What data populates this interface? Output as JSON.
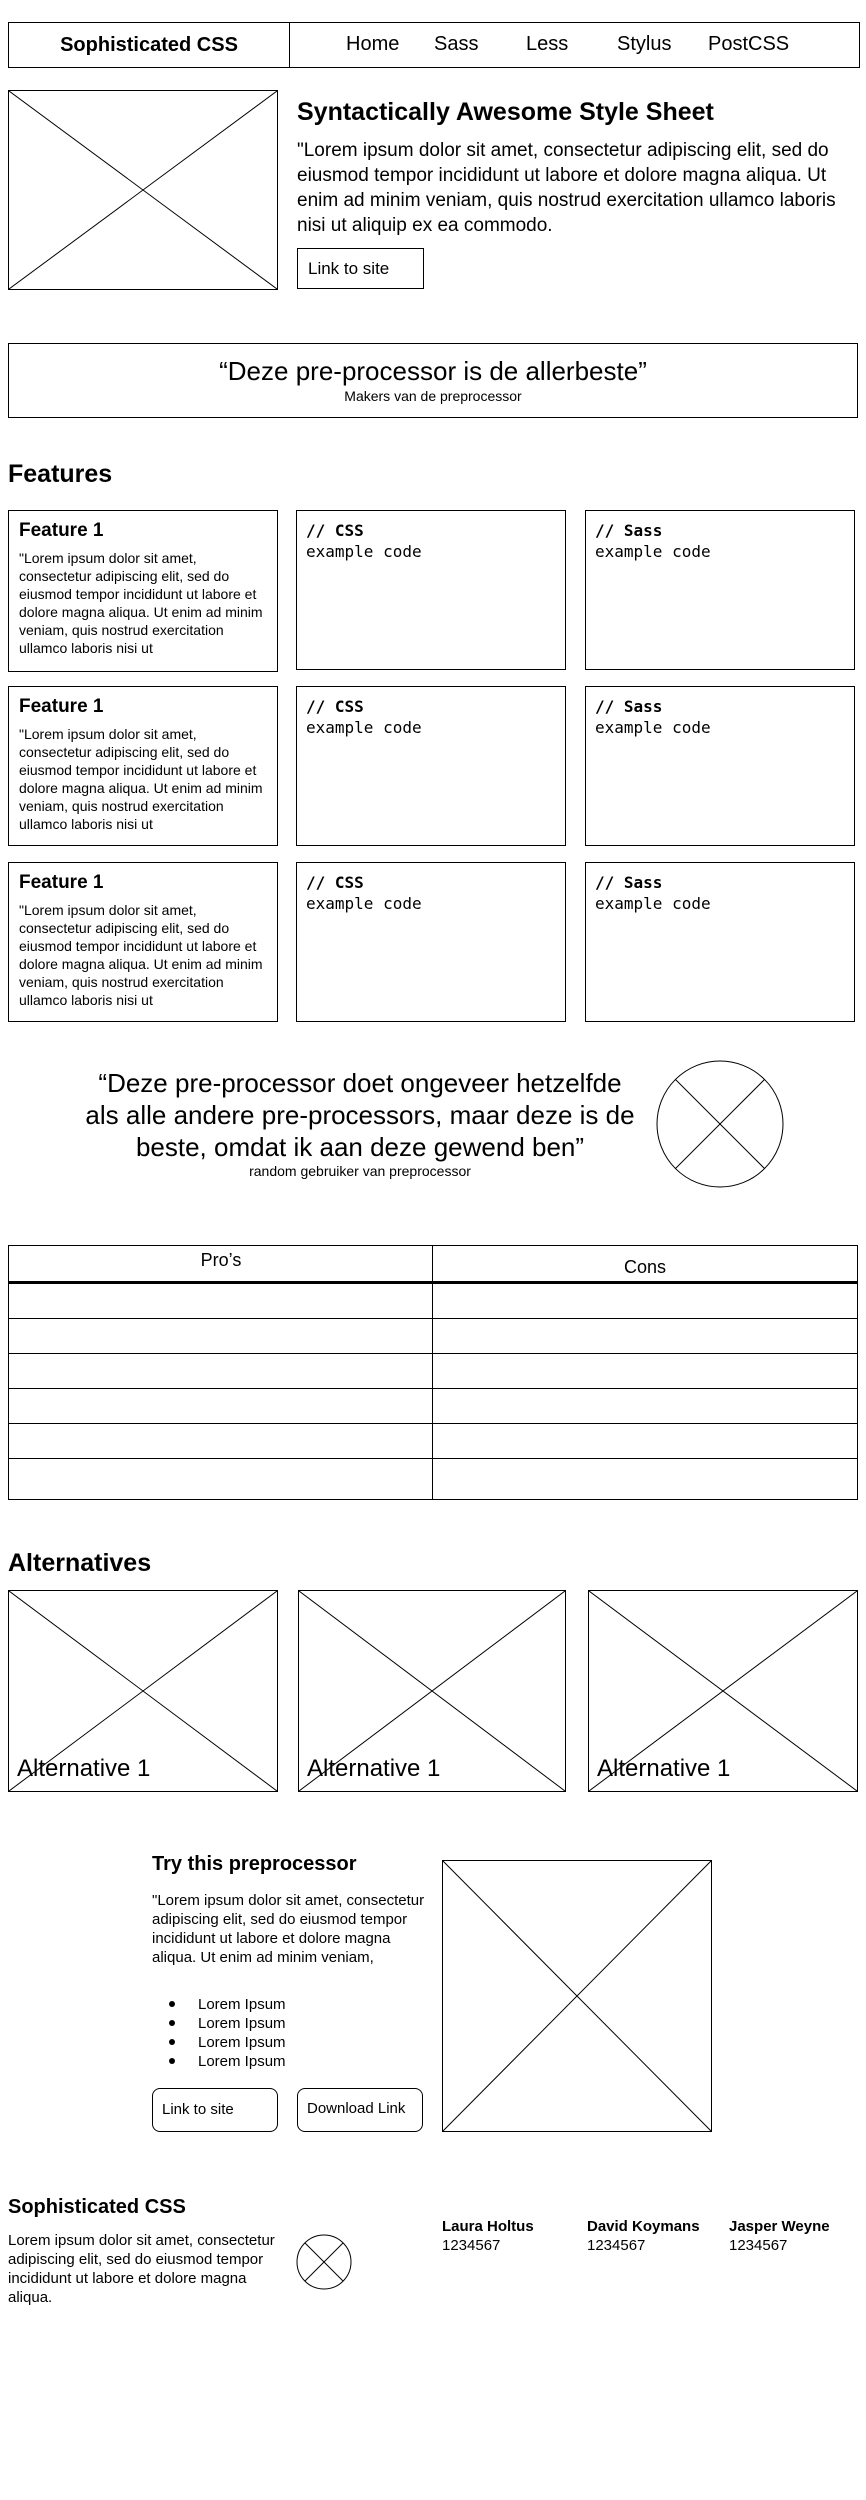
{
  "header": {
    "brand": "Sophisticated CSS",
    "nav": [
      "Home",
      "Sass",
      "Less",
      "Stylus",
      "PostCSS"
    ]
  },
  "hero": {
    "title": "Syntactically Awesome Style Sheet",
    "text": "\"Lorem ipsum dolor sit amet, consectetur adipiscing elit, sed do eiusmod tempor incididunt ut labore et dolore magna aliqua. Ut enim ad minim veniam, quis nostrud exercitation ullamco laboris nisi ut aliquip ex ea commodo.",
    "link_label": "Link to site"
  },
  "quote1": {
    "text": "“Deze pre-processor is de allerbeste”",
    "author": "Makers van de preprocessor"
  },
  "features": {
    "title": "Features",
    "rows": [
      {
        "title": "Feature 1",
        "text": "\"Lorem ipsum dolor sit amet, consectetur adipiscing elit, sed do eiusmod tempor incididunt ut labore et dolore magna aliqua. Ut enim ad minim veniam, quis nostrud exercitation ullamco laboris nisi ut",
        "css_comment": "// CSS",
        "css_code": "example code",
        "sass_comment": "// Sass",
        "sass_code": "example code"
      },
      {
        "title": "Feature 1",
        "text": "\"Lorem ipsum dolor sit amet, consectetur adipiscing elit, sed do eiusmod tempor incididunt ut labore et dolore magna aliqua. Ut enim ad minim veniam, quis nostrud exercitation ullamco laboris nisi ut",
        "css_comment": "// CSS",
        "css_code": "example code",
        "sass_comment": "// Sass",
        "sass_code": "example code"
      },
      {
        "title": "Feature 1",
        "text": "\"Lorem ipsum dolor sit amet, consectetur adipiscing elit, sed do eiusmod tempor incididunt ut labore et dolore magna aliqua. Ut enim ad minim veniam, quis nostrud exercitation ullamco laboris nisi ut",
        "css_comment": "// CSS",
        "css_code": "example code",
        "sass_comment": "// Sass",
        "sass_code": "example code"
      }
    ]
  },
  "quote2": {
    "text": "“Deze pre-processor doet ongeveer hetzelfde als alle andere pre-processors, maar deze is de beste, omdat ik aan deze gewend ben”",
    "author": "random gebruiker van preprocessor"
  },
  "pros_cons": {
    "pros_header": "Pro’s",
    "cons_header": "Cons"
  },
  "alternatives": {
    "title": "Alternatives",
    "items": [
      "Alternative 1",
      "Alternative 1",
      "Alternative 1"
    ]
  },
  "try": {
    "title": "Try this preprocessor",
    "text": "\"Lorem ipsum dolor sit amet, consectetur adipiscing elit, sed do eiusmod tempor incididunt ut labore et dolore magna aliqua. Ut enim ad minim veniam,",
    "list": [
      "Lorem Ipsum",
      "Lorem Ipsum",
      "Lorem Ipsum",
      "Lorem Ipsum"
    ],
    "link_label": "Link to site",
    "download_label": "Download Link"
  },
  "footer": {
    "brand": "Sophisticated CSS",
    "text": "Lorem ipsum dolor sit amet, consectetur adipiscing elit, sed do eiusmod tempor incididunt ut labore et dolore magna aliqua.",
    "contacts": [
      {
        "name": "Laura Holtus",
        "number": "1234567"
      },
      {
        "name": "David Koymans",
        "number": "1234567"
      },
      {
        "name": "Jasper Weyne",
        "number": "1234567"
      }
    ]
  }
}
